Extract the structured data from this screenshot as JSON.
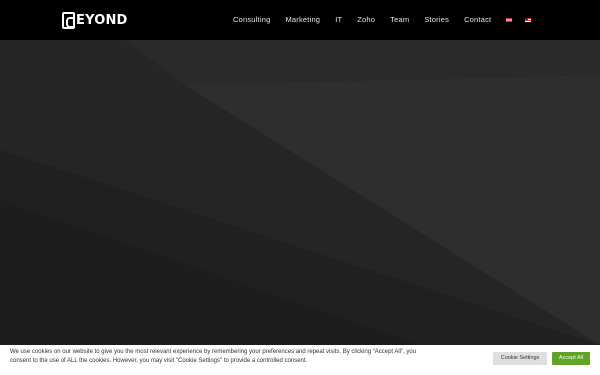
{
  "brand": {
    "logo_text": "EYOND"
  },
  "nav": {
    "items": [
      "Consulting",
      "Marketing",
      "IT",
      "Zoho",
      "Team",
      "Stories",
      "Contact"
    ],
    "languages": [
      "austria-flag-icon",
      "us-flag-icon"
    ]
  },
  "hero": {
    "background": "#222222"
  },
  "cookie": {
    "text": "We use cookies on our website to give you the most relevant experience by remembering your preferences and repeat visits. By clicking “Accept All”, you consent to the use of ALL the cookies. However, you may visit \"Cookie Settings\" to provide a controlled consent.",
    "settings_label": "Cookie Settings",
    "accept_label": "Accept All"
  },
  "colors": {
    "header": "#000000",
    "accept": "#61a229",
    "settings": "#dedfe0"
  }
}
